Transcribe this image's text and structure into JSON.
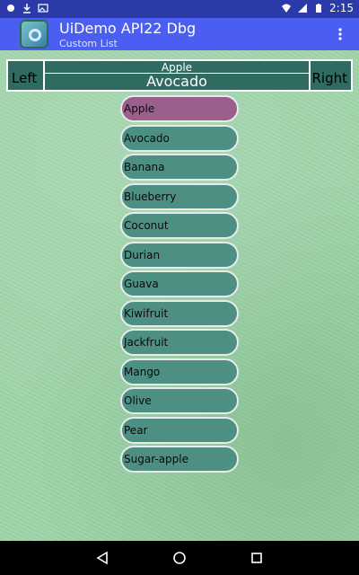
{
  "status_bar": {
    "time": "2:15"
  },
  "app": {
    "title": "UiDemo API22 Dbg",
    "subtitle": "Custom List"
  },
  "header": {
    "left_label": "Left",
    "right_label": "Right",
    "top_text": "Apple",
    "selected_text": "Avocado"
  },
  "list": {
    "items": [
      {
        "label": "Apple",
        "selected": true
      },
      {
        "label": "Avocado"
      },
      {
        "label": "Banana"
      },
      {
        "label": "Blueberry"
      },
      {
        "label": "Coconut"
      },
      {
        "label": "Durian"
      },
      {
        "label": "Guava"
      },
      {
        "label": "Kiwifruit"
      },
      {
        "label": "Jackfruit"
      },
      {
        "label": "Mango"
      },
      {
        "label": "Olive"
      },
      {
        "label": "Pear"
      },
      {
        "label": "Sugar-apple"
      }
    ]
  },
  "colors": {
    "status_bar": "#2b3aa8",
    "action_bar": "#4a5ff2",
    "list_item": "#4e8f84",
    "list_item_selected": "#9a5f8b",
    "background": "#9fd5aa"
  },
  "icons": {
    "status_left": [
      "notification-icon",
      "download-icon",
      "picture-icon"
    ],
    "status_right": [
      "wifi-icon",
      "signal-icon",
      "battery-icon"
    ],
    "overflow": "more-vert-icon",
    "nav": [
      "back-icon",
      "home-icon",
      "recent-apps-icon"
    ]
  }
}
